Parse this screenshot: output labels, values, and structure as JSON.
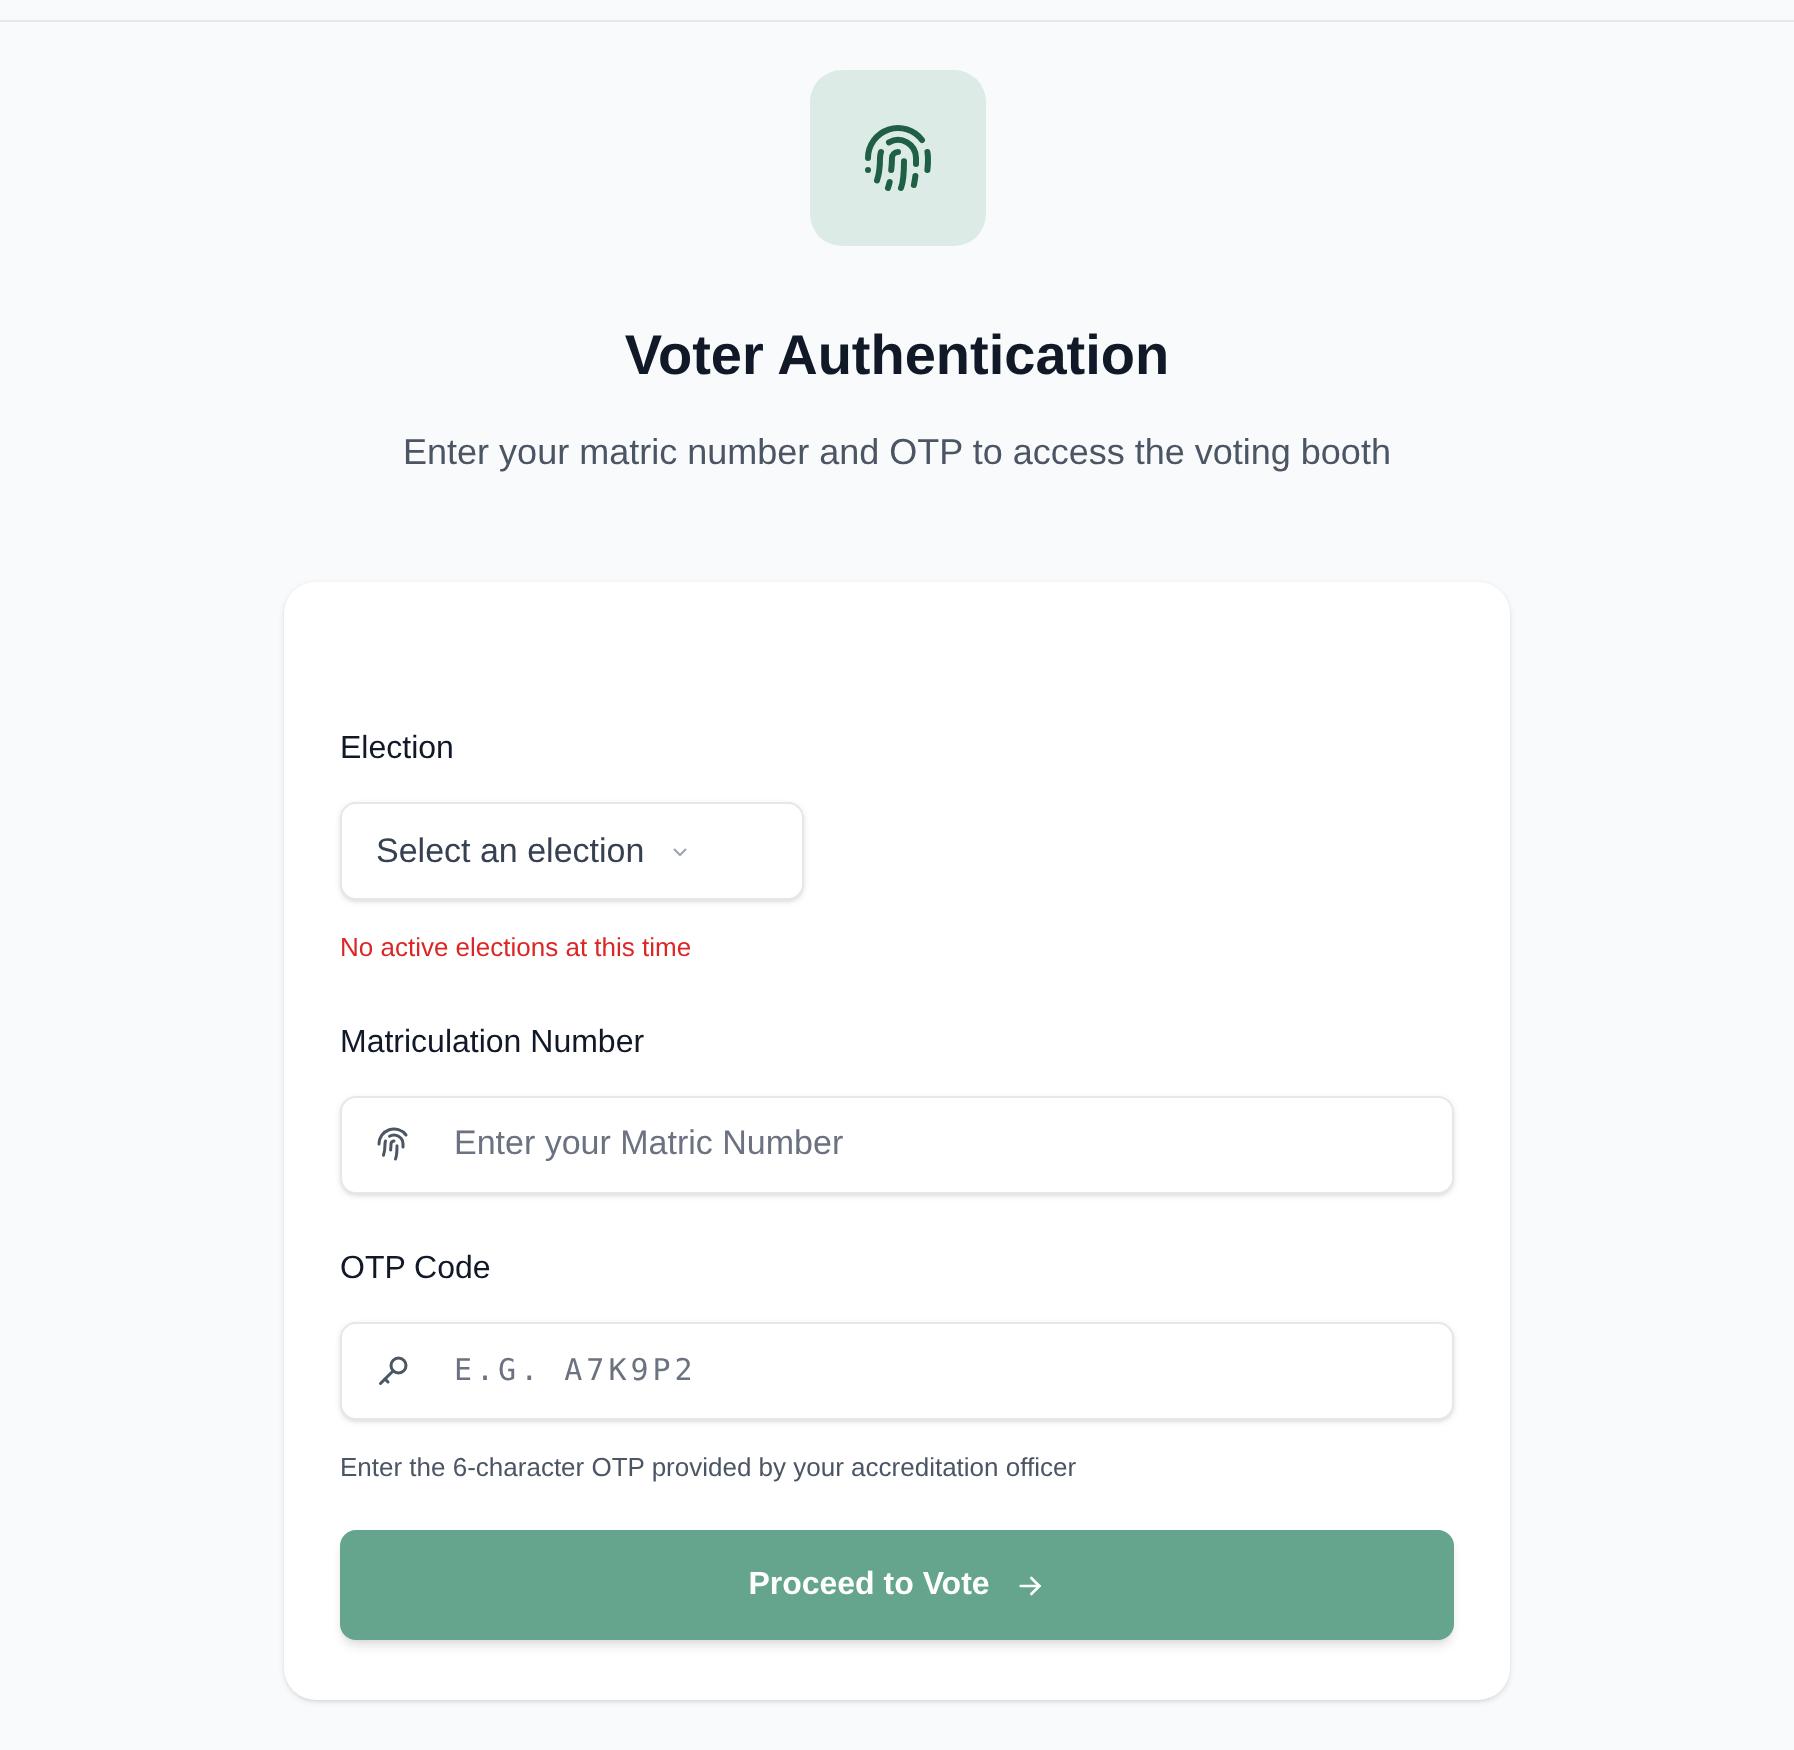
{
  "header": {
    "title": "Voter Authentication",
    "subtitle": "Enter your matric number and OTP to access the voting booth"
  },
  "form": {
    "fields": [
      {
        "kind": "select",
        "label": "Election",
        "placeholder": "Select an election",
        "error": "No active elections at this time"
      },
      {
        "kind": "text",
        "label": "Matriculation Number",
        "placeholder": "Enter your Matric Number"
      },
      {
        "kind": "code",
        "label": "OTP Code",
        "placeholder": "E.G. A7K9P2",
        "hint": "Enter the 6-character OTP provided by your accreditation officer"
      }
    ],
    "submit": {
      "label": "Proceed to Vote",
      "disabled": true
    }
  }
}
